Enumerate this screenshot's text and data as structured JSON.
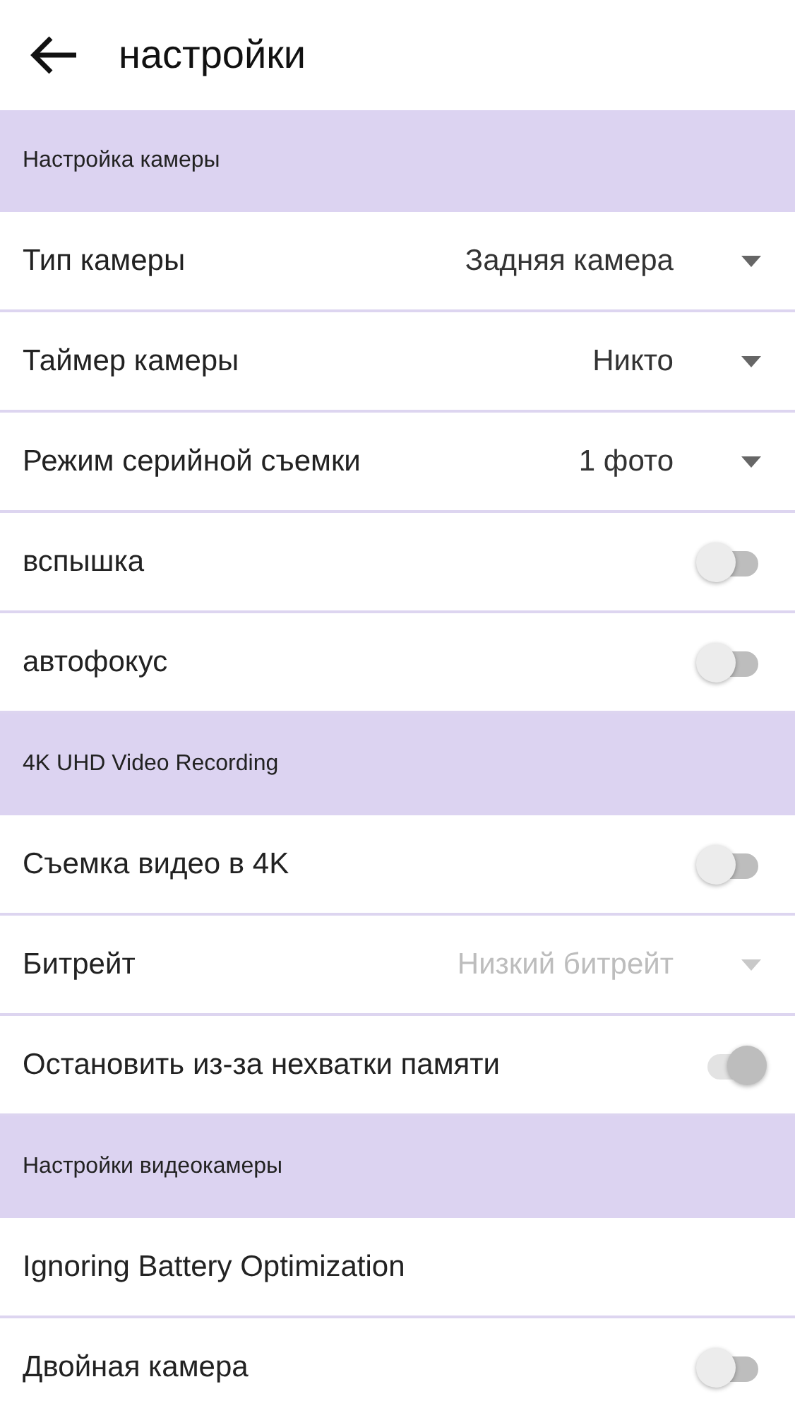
{
  "toolbar": {
    "title": "настройки"
  },
  "sections": [
    {
      "header": "Настройка камеры",
      "items": [
        {
          "kind": "dropdown",
          "label": "Тип камеры",
          "value": "Задняя камера",
          "disabled": false
        },
        {
          "kind": "dropdown",
          "label": "Таймер камеры",
          "value": "Никто",
          "disabled": false
        },
        {
          "kind": "dropdown",
          "label": "Режим серийной съемки",
          "value": "1 фото",
          "disabled": false
        },
        {
          "kind": "switch",
          "label": "вспышка",
          "on": false,
          "disabled": false
        },
        {
          "kind": "switch",
          "label": "автофокус",
          "on": false,
          "disabled": false
        }
      ]
    },
    {
      "header": "4K UHD Video Recording",
      "items": [
        {
          "kind": "switch",
          "label": "Съемка видео в 4K",
          "on": false,
          "disabled": false
        },
        {
          "kind": "dropdown",
          "label": "Битрейт",
          "value": "Низкий битрейт",
          "disabled": true
        },
        {
          "kind": "switch",
          "label": "Остановить из-за нехватки памяти",
          "on": true,
          "disabled": true
        }
      ]
    },
    {
      "header": "Настройки видеокамеры",
      "items": [
        {
          "kind": "plain",
          "label": "Ignoring Battery Optimization"
        },
        {
          "kind": "switch",
          "label": "Двойная камера",
          "on": false,
          "disabled": false
        }
      ]
    }
  ]
}
